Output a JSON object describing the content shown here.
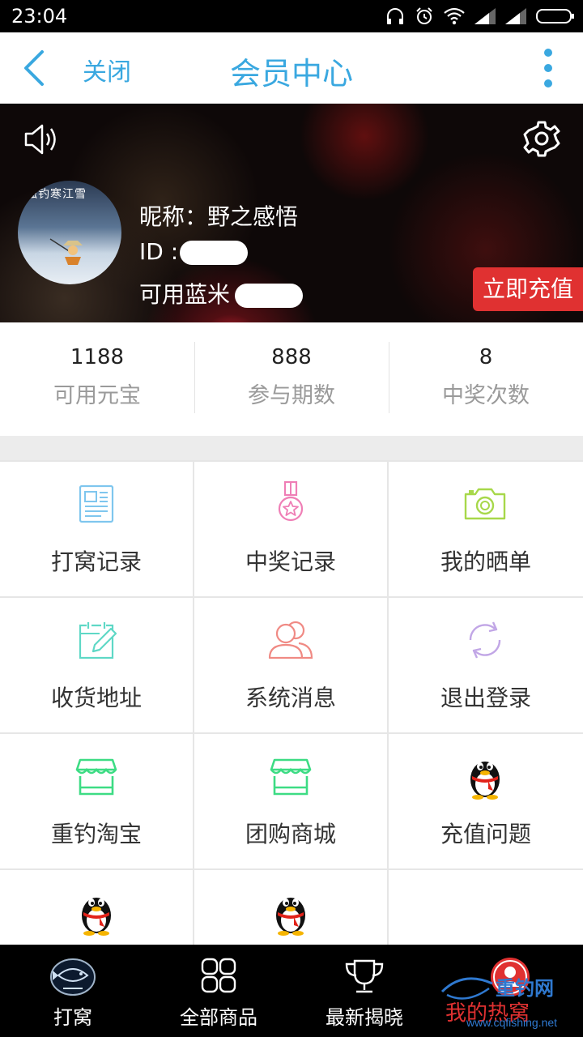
{
  "status_bar": {
    "time": "23:04"
  },
  "header": {
    "close_label": "关闭",
    "title": "会员中心"
  },
  "profile": {
    "nickname_label": "昵称：",
    "nickname": "野之感悟",
    "id_label": "ID :",
    "coins_label": "可用蓝米",
    "recharge_label": "立即充值",
    "avatar_text": "独钓寒江雪"
  },
  "stats": [
    {
      "value": "1188",
      "label": "可用元宝"
    },
    {
      "value": "888",
      "label": "参与期数"
    },
    {
      "value": "8",
      "label": "中奖次数"
    }
  ],
  "menu": [
    {
      "label": "打窝记录",
      "icon": "document-icon",
      "color": "#7fc6ee"
    },
    {
      "label": "中奖记录",
      "icon": "medal-icon",
      "color": "#ef7fb6"
    },
    {
      "label": "我的晒单",
      "icon": "camera-icon",
      "color": "#a7d84a"
    },
    {
      "label": "收货地址",
      "icon": "calendar-edit-icon",
      "color": "#5fd8c6"
    },
    {
      "label": "系统消息",
      "icon": "users-icon",
      "color": "#f08a84"
    },
    {
      "label": "退出登录",
      "icon": "refresh-icon",
      "color": "#c1a6e6"
    },
    {
      "label": "重钓淘宝",
      "icon": "shop-icon",
      "color": "#3ddc84"
    },
    {
      "label": "团购商城",
      "icon": "shop-icon",
      "color": "#3ddc84"
    },
    {
      "label": "充值问题",
      "icon": "qq-penguin-icon",
      "color": "#000000"
    },
    {
      "label": "",
      "icon": "qq-penguin-icon",
      "color": "#000000"
    },
    {
      "label": "",
      "icon": "qq-penguin-icon",
      "color": "#000000"
    }
  ],
  "bottom_nav": [
    {
      "label": "打窝",
      "icon": "fish-logo-icon"
    },
    {
      "label": "全部商品",
      "icon": "grid-icon"
    },
    {
      "label": "最新揭晓",
      "icon": "trophy-icon"
    },
    {
      "label": "",
      "icon": "profile-icon"
    }
  ],
  "watermark": {
    "title": "重钓网",
    "subtitle": "我的热窝",
    "url": "www.cqfishing.net"
  },
  "colors": {
    "accent": "#3aa8e0",
    "recharge": "#e03131"
  }
}
